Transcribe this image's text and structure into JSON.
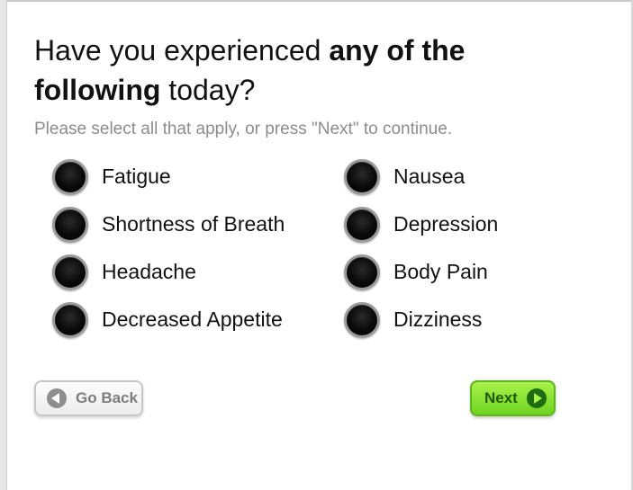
{
  "question": {
    "part1": "Have you experienced ",
    "bold1": "any of the",
    "bold2": "following",
    "part2": " today?"
  },
  "instructions": "Please select all that apply, or press \"Next\" to continue.",
  "options": [
    {
      "label": "Fatigue",
      "selected": false
    },
    {
      "label": "Nausea",
      "selected": false
    },
    {
      "label": "Shortness of Breath",
      "selected": false
    },
    {
      "label": "Depression",
      "selected": false
    },
    {
      "label": "Headache",
      "selected": false
    },
    {
      "label": "Body Pain",
      "selected": false
    },
    {
      "label": "Decreased Appetite",
      "selected": false
    },
    {
      "label": "Dizziness",
      "selected": false
    }
  ],
  "buttons": {
    "back_label": "Go Back",
    "back_icon": "back-arrow-icon",
    "next_label": "Next",
    "next_icon": "next-arrow-icon"
  },
  "colors": {
    "next_button": "#7ddc2a",
    "instructions_text": "#8c8c8c",
    "radio_fill": "#000000"
  }
}
